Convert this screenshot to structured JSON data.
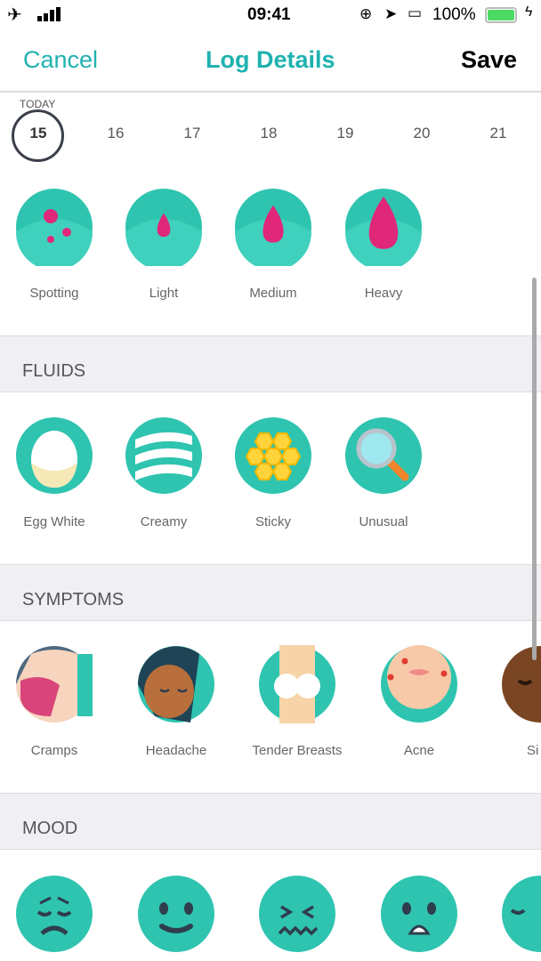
{
  "status_bar": {
    "time": "09:41",
    "battery": "100%",
    "icons": [
      "airplane-icon",
      "signal-icon",
      "rotation-lock-icon",
      "location-icon",
      "airplay-icon",
      "battery-icon",
      "charging-icon"
    ]
  },
  "nav": {
    "cancel": "Cancel",
    "title": "Log Details",
    "save": "Save"
  },
  "dates": {
    "today_label": "TODAY",
    "days": [
      "15",
      "16",
      "17",
      "18",
      "19",
      "20",
      "21"
    ],
    "selected": "15"
  },
  "flow": {
    "items": [
      {
        "label": "Spotting"
      },
      {
        "label": "Light"
      },
      {
        "label": "Medium"
      },
      {
        "label": "Heavy"
      }
    ]
  },
  "fluids": {
    "title": "FLUIDS",
    "items": [
      {
        "label": "Egg White"
      },
      {
        "label": "Creamy"
      },
      {
        "label": "Sticky"
      },
      {
        "label": "Unusual"
      }
    ]
  },
  "symptoms": {
    "title": "SYMPTOMS",
    "items": [
      {
        "label": "Cramps"
      },
      {
        "label": "Headache"
      },
      {
        "label": "Tender Breasts"
      },
      {
        "label": "Acne"
      },
      {
        "label": "Si"
      }
    ]
  },
  "mood": {
    "title": "MOOD",
    "items": [
      "sad-face-icon",
      "happy-face-icon",
      "distressed-face-icon",
      "worried-face-icon",
      "sleepy-face-icon"
    ]
  },
  "colors": {
    "accent": "#1fb2b0",
    "teal": "#2ec4b0",
    "pink": "#e0277a"
  }
}
